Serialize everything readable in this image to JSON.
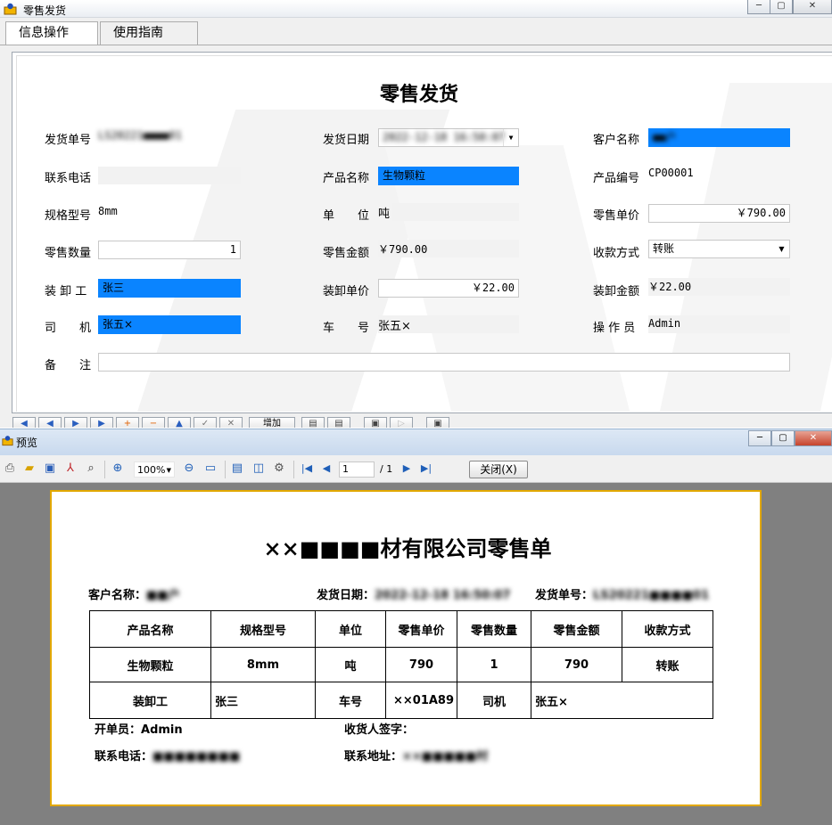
{
  "main_window": {
    "title": "零售发货",
    "controls": {
      "minimize": "─",
      "maximize": "▢",
      "close": "✕"
    },
    "tabs": [
      {
        "label": "信息操作",
        "active": true
      },
      {
        "label": "使用指南",
        "active": false
      }
    ],
    "form": {
      "title": "零售发货",
      "fields": {
        "order_no": {
          "label": "发货单号",
          "value": "LS20221■■■■01"
        },
        "ship_date": {
          "label": "发货日期",
          "value": "2022-12-18 16:50:07"
        },
        "customer": {
          "label": "客户名称",
          "value": "■■户"
        },
        "phone": {
          "label": "联系电话",
          "value": ""
        },
        "product_name": {
          "label": "产品名称",
          "value": "生物颗粒"
        },
        "product_code": {
          "label": "产品编号",
          "value": "CP00001"
        },
        "spec": {
          "label": "规格型号",
          "value": "8mm"
        },
        "unit": {
          "label": "单　　位",
          "value": "吨"
        },
        "unit_price": {
          "label": "零售单价",
          "value": "￥790.00"
        },
        "quantity": {
          "label": "零售数量",
          "value": "1"
        },
        "amount": {
          "label": "零售金额",
          "value": "￥790.00"
        },
        "payment": {
          "label": "收款方式",
          "value": "转账"
        },
        "loader": {
          "label": "装 卸 工",
          "value": "张三"
        },
        "load_price": {
          "label": "装卸单价",
          "value": "￥22.00"
        },
        "load_amount": {
          "label": "装卸金额",
          "value": "￥22.00"
        },
        "driver": {
          "label": "司　　机",
          "value": "张五×"
        },
        "plate": {
          "label": "车　　号",
          "value": "张五×"
        },
        "operator": {
          "label": "操 作 员",
          "value": "Admin"
        },
        "remark": {
          "label": "备　　注",
          "value": ""
        }
      }
    },
    "bottom_toolbar": {
      "add_label": "增加"
    }
  },
  "preview_window": {
    "title": "预览",
    "zoom": "100%",
    "page_current": "1",
    "page_total": "/ 1",
    "close_label": "关闭(X)",
    "report": {
      "title": "××■■■■材有限公司零售单",
      "customer_label": "客户名称：",
      "customer_value": "■■户",
      "date_label": "发货日期：",
      "date_value": "2022-12-18 16:50:07",
      "order_label": "发货单号：",
      "order_value": "LS20221■■■■01",
      "headers": [
        "产品名称",
        "规格型号",
        "单位",
        "零售单价",
        "零售数量",
        "零售金额",
        "收款方式"
      ],
      "row": [
        "生物颗粒",
        "8mm",
        "吨",
        "790",
        "1",
        "790",
        "转账"
      ],
      "footer_row": {
        "loader_label": "装卸工",
        "loader_value": "张三",
        "plate_label": "车号",
        "plate_value": "××01A89",
        "driver_label": "司机",
        "driver_value": "张五×"
      },
      "issuer_label": "开单员：",
      "issuer_value": "Admin",
      "receiver_label": "收货人签字：",
      "phone_label": "联系电话：",
      "phone_value": "■■■■■■■■",
      "address_label": "联系地址：",
      "address_value": "××■■■■■村"
    }
  }
}
